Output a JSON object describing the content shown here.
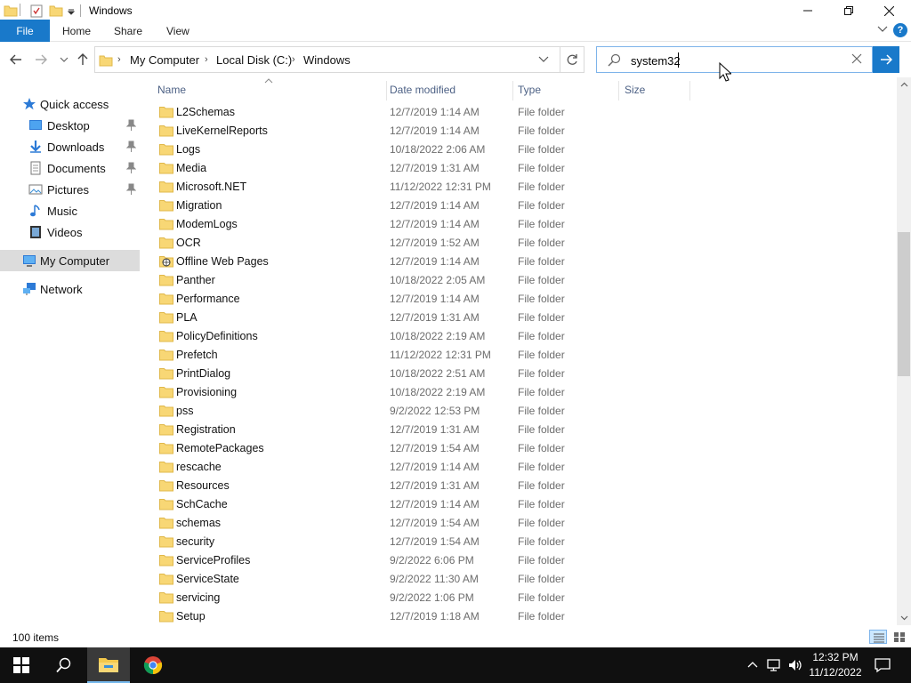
{
  "window": {
    "title": "Windows"
  },
  "ribbon": {
    "file_label": "File",
    "tabs": [
      {
        "label": "Home"
      },
      {
        "label": "Share"
      },
      {
        "label": "View"
      }
    ],
    "help_label": "?"
  },
  "address": {
    "crumbs": [
      {
        "label": "My Computer"
      },
      {
        "label": "Local Disk (C:)"
      },
      {
        "label": "Windows"
      }
    ]
  },
  "search": {
    "value": "system32",
    "placeholder": ""
  },
  "sidebar": {
    "items": [
      {
        "label": "Quick access",
        "icon": "star-icon",
        "pinned": false
      },
      {
        "label": "Desktop",
        "icon": "desktop-icon",
        "pinned": true
      },
      {
        "label": "Downloads",
        "icon": "download-icon",
        "pinned": true
      },
      {
        "label": "Documents",
        "icon": "documents-icon",
        "pinned": true
      },
      {
        "label": "Pictures",
        "icon": "pictures-icon",
        "pinned": true
      },
      {
        "label": "Music",
        "icon": "music-icon",
        "pinned": false
      },
      {
        "label": "Videos",
        "icon": "videos-icon",
        "pinned": false
      },
      {
        "label": "My Computer",
        "icon": "computer-icon",
        "pinned": false,
        "selected": true
      },
      {
        "label": "Network",
        "icon": "network-icon",
        "pinned": false
      }
    ]
  },
  "filelist": {
    "columns": {
      "name": "Name",
      "date": "Date modified",
      "type": "Type",
      "size": "Size"
    },
    "rows": [
      {
        "name": "L2Schemas",
        "date": "12/7/2019 1:14 AM",
        "type": "File folder"
      },
      {
        "name": "LiveKernelReports",
        "date": "12/7/2019 1:14 AM",
        "type": "File folder"
      },
      {
        "name": "Logs",
        "date": "10/18/2022 2:06 AM",
        "type": "File folder"
      },
      {
        "name": "Media",
        "date": "12/7/2019 1:31 AM",
        "type": "File folder"
      },
      {
        "name": "Microsoft.NET",
        "date": "11/12/2022 12:31 PM",
        "type": "File folder"
      },
      {
        "name": "Migration",
        "date": "12/7/2019 1:14 AM",
        "type": "File folder"
      },
      {
        "name": "ModemLogs",
        "date": "12/7/2019 1:14 AM",
        "type": "File folder"
      },
      {
        "name": "OCR",
        "date": "12/7/2019 1:52 AM",
        "type": "File folder"
      },
      {
        "name": "Offline Web Pages",
        "date": "12/7/2019 1:14 AM",
        "type": "File folder",
        "special": true
      },
      {
        "name": "Panther",
        "date": "10/18/2022 2:05 AM",
        "type": "File folder"
      },
      {
        "name": "Performance",
        "date": "12/7/2019 1:14 AM",
        "type": "File folder"
      },
      {
        "name": "PLA",
        "date": "12/7/2019 1:31 AM",
        "type": "File folder"
      },
      {
        "name": "PolicyDefinitions",
        "date": "10/18/2022 2:19 AM",
        "type": "File folder"
      },
      {
        "name": "Prefetch",
        "date": "11/12/2022 12:31 PM",
        "type": "File folder"
      },
      {
        "name": "PrintDialog",
        "date": "10/18/2022 2:51 AM",
        "type": "File folder"
      },
      {
        "name": "Provisioning",
        "date": "10/18/2022 2:19 AM",
        "type": "File folder"
      },
      {
        "name": "pss",
        "date": "9/2/2022 12:53 PM",
        "type": "File folder"
      },
      {
        "name": "Registration",
        "date": "12/7/2019 1:31 AM",
        "type": "File folder"
      },
      {
        "name": "RemotePackages",
        "date": "12/7/2019 1:54 AM",
        "type": "File folder"
      },
      {
        "name": "rescache",
        "date": "12/7/2019 1:14 AM",
        "type": "File folder"
      },
      {
        "name": "Resources",
        "date": "12/7/2019 1:31 AM",
        "type": "File folder"
      },
      {
        "name": "SchCache",
        "date": "12/7/2019 1:14 AM",
        "type": "File folder"
      },
      {
        "name": "schemas",
        "date": "12/7/2019 1:54 AM",
        "type": "File folder"
      },
      {
        "name": "security",
        "date": "12/7/2019 1:54 AM",
        "type": "File folder"
      },
      {
        "name": "ServiceProfiles",
        "date": "9/2/2022 6:06 PM",
        "type": "File folder"
      },
      {
        "name": "ServiceState",
        "date": "9/2/2022 11:30 AM",
        "type": "File folder"
      },
      {
        "name": "servicing",
        "date": "9/2/2022 1:06 PM",
        "type": "File folder"
      },
      {
        "name": "Setup",
        "date": "12/7/2019 1:18 AM",
        "type": "File folder"
      }
    ]
  },
  "status": {
    "item_count": "100 items"
  },
  "taskbar": {
    "time": "12:32 PM",
    "date": "11/12/2022"
  },
  "colors": {
    "accent": "#1979ca",
    "folder": "#f8d775",
    "folder_dark": "#e0b84a",
    "taskbar": "#101010"
  }
}
